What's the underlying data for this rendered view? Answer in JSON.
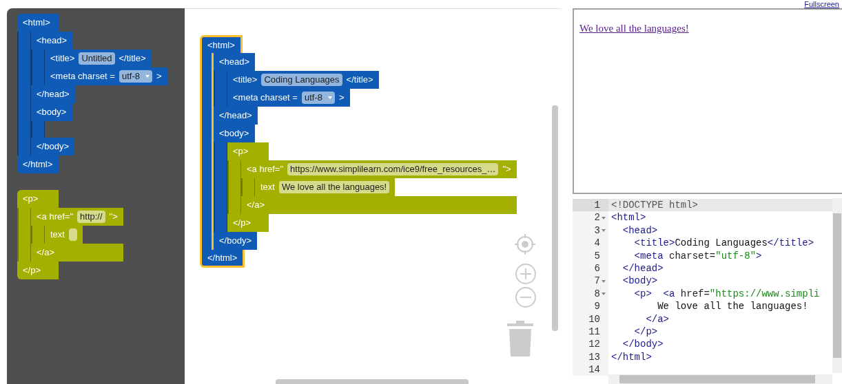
{
  "header": {
    "fullscreen_link": "Fullscreen"
  },
  "toolbox": {
    "blocks": [
      {
        "kind": "container",
        "color": "#0f5bb5",
        "selected": false,
        "head": [
          {
            "kind": "text",
            "value": "<html>"
          }
        ],
        "tail": "</html>",
        "children": [
          {
            "kind": "container",
            "color": "#0f5bb5",
            "selected": false,
            "head": [
              {
                "kind": "text",
                "value": "<head>"
              }
            ],
            "tail": "</head>",
            "children": [
              {
                "kind": "statement",
                "parts": [
                  {
                    "kind": "text",
                    "value": "<title>"
                  },
                  {
                    "kind": "field",
                    "value": "Untitled"
                  },
                  {
                    "kind": "text",
                    "value": "</title>"
                  }
                ]
              },
              {
                "kind": "statement",
                "parts": [
                  {
                    "kind": "text",
                    "value": "<meta charset ="
                  },
                  {
                    "kind": "dropdown",
                    "value": "utf-8"
                  },
                  {
                    "kind": "text",
                    "value": ">"
                  }
                ]
              }
            ]
          },
          {
            "kind": "container",
            "color": "#0f5bb5",
            "selected": false,
            "head": [
              {
                "kind": "text",
                "value": "<body>"
              }
            ],
            "tail": "</body>"
          }
        ]
      },
      {
        "kind": "container",
        "color": "#a4b000",
        "selected": false,
        "head": [
          {
            "kind": "text",
            "value": "<p>"
          }
        ],
        "tail": "</p>",
        "children": [
          {
            "kind": "container",
            "color": "#a4b000",
            "selected": false,
            "head": [
              {
                "kind": "text",
                "value": "<a href=\""
              },
              {
                "kind": "field",
                "value": "http://"
              },
              {
                "kind": "text",
                "value": "\">"
              }
            ],
            "tail": "</a>",
            "children": [
              {
                "kind": "statement",
                "parts": [
                  {
                    "kind": "text",
                    "value": "text"
                  },
                  {
                    "kind": "field"
                  }
                ]
              }
            ]
          }
        ]
      }
    ]
  },
  "workspace": {
    "blocks": [
      {
        "kind": "container",
        "color": "#0f5bb5",
        "selected": true,
        "head": [
          {
            "kind": "text",
            "value": "<html>"
          }
        ],
        "tail": "</html>",
        "children": [
          {
            "kind": "container",
            "color": "#0f5bb5",
            "selected": false,
            "head": [
              {
                "kind": "text",
                "value": "<head>"
              }
            ],
            "tail": "</head>",
            "children": [
              {
                "kind": "statement",
                "parts": [
                  {
                    "kind": "text",
                    "value": "<title>"
                  },
                  {
                    "kind": "field",
                    "value": "Coding Languages"
                  },
                  {
                    "kind": "text",
                    "value": "</title>"
                  }
                ]
              },
              {
                "kind": "statement",
                "parts": [
                  {
                    "kind": "text",
                    "value": "<meta charset ="
                  },
                  {
                    "kind": "dropdown",
                    "value": "utf-8"
                  },
                  {
                    "kind": "text",
                    "value": ">"
                  }
                ]
              }
            ]
          },
          {
            "kind": "container",
            "color": "#0f5bb5",
            "selected": false,
            "head": [
              {
                "kind": "text",
                "value": "<body>"
              }
            ],
            "tail": "</body>",
            "children": [
              {
                "kind": "container",
                "color": "#a4b000",
                "selected": false,
                "head": [
                  {
                    "kind": "text",
                    "value": "<p>"
                  }
                ],
                "tail": "</p>",
                "children": [
                  {
                    "kind": "container",
                    "color": "#a4b000",
                    "selected": false,
                    "head": [
                      {
                        "kind": "text",
                        "value": "<a href=\""
                      },
                      {
                        "kind": "field",
                        "value": "https://www.simplilearn.com/ice9/free_resources_…"
                      },
                      {
                        "kind": "text",
                        "value": "\">"
                      }
                    ],
                    "tail": "</a>",
                    "children": [
                      {
                        "kind": "statement",
                        "parts": [
                          {
                            "kind": "text",
                            "value": "text"
                          },
                          {
                            "kind": "field",
                            "value": "We love all the languages!"
                          }
                        ]
                      }
                    ]
                  }
                ]
              }
            ]
          }
        ]
      }
    ]
  },
  "preview": {
    "link": "We love all the languages!"
  },
  "code": {
    "lines": [
      {
        "number": "1",
        "fold": false,
        "active": true,
        "tokens": [
          {
            "kind": "doctype",
            "text": "<!DOCTYPE html>"
          }
        ]
      },
      {
        "number": "2",
        "fold": true,
        "active": false,
        "tokens": [
          {
            "kind": "tag",
            "text": "<html>"
          }
        ]
      },
      {
        "number": "3",
        "fold": true,
        "active": false,
        "tokens": [
          {
            "kind": "tag",
            "text": "  <head>"
          }
        ]
      },
      {
        "number": "4",
        "fold": false,
        "active": false,
        "tokens": [
          {
            "kind": "tag",
            "text": "    <title>"
          },
          {
            "kind": "text",
            "text": "Coding Languages"
          },
          {
            "kind": "tag",
            "text": "</title>"
          }
        ]
      },
      {
        "number": "5",
        "fold": false,
        "active": false,
        "tokens": [
          {
            "kind": "tag",
            "text": "    <meta"
          },
          {
            "kind": "attr",
            "text": " charset="
          },
          {
            "kind": "string",
            "text": "\"utf-8\""
          },
          {
            "kind": "tag",
            "text": ">"
          }
        ]
      },
      {
        "number": "6",
        "fold": false,
        "active": false,
        "tokens": [
          {
            "kind": "tag",
            "text": "  </head>"
          }
        ]
      },
      {
        "number": "7",
        "fold": true,
        "active": false,
        "tokens": [
          {
            "kind": "tag",
            "text": "  <body>"
          }
        ]
      },
      {
        "number": "8",
        "fold": true,
        "active": false,
        "tokens": [
          {
            "kind": "tag",
            "text": "    <p>"
          },
          {
            "kind": "tag",
            "text": "  <a"
          },
          {
            "kind": "attr",
            "text": " href="
          },
          {
            "kind": "string",
            "text": "\"https://www.simpli"
          }
        ]
      },
      {
        "number": "9",
        "fold": false,
        "active": false,
        "tokens": [
          {
            "kind": "text",
            "text": "        We love all the languages!"
          }
        ]
      },
      {
        "number": "10",
        "fold": false,
        "active": false,
        "tokens": [
          {
            "kind": "tag",
            "text": "      </a>"
          }
        ]
      },
      {
        "number": "11",
        "fold": false,
        "active": false,
        "tokens": [
          {
            "kind": "tag",
            "text": "    </p>"
          }
        ]
      },
      {
        "number": "12",
        "fold": false,
        "active": false,
        "tokens": [
          {
            "kind": "tag",
            "text": "  </body>"
          }
        ]
      },
      {
        "number": "13",
        "fold": false,
        "active": false,
        "tokens": [
          {
            "kind": "tag",
            "text": "</html>"
          }
        ]
      },
      {
        "number": "14",
        "fold": false,
        "active": false
      }
    ]
  }
}
